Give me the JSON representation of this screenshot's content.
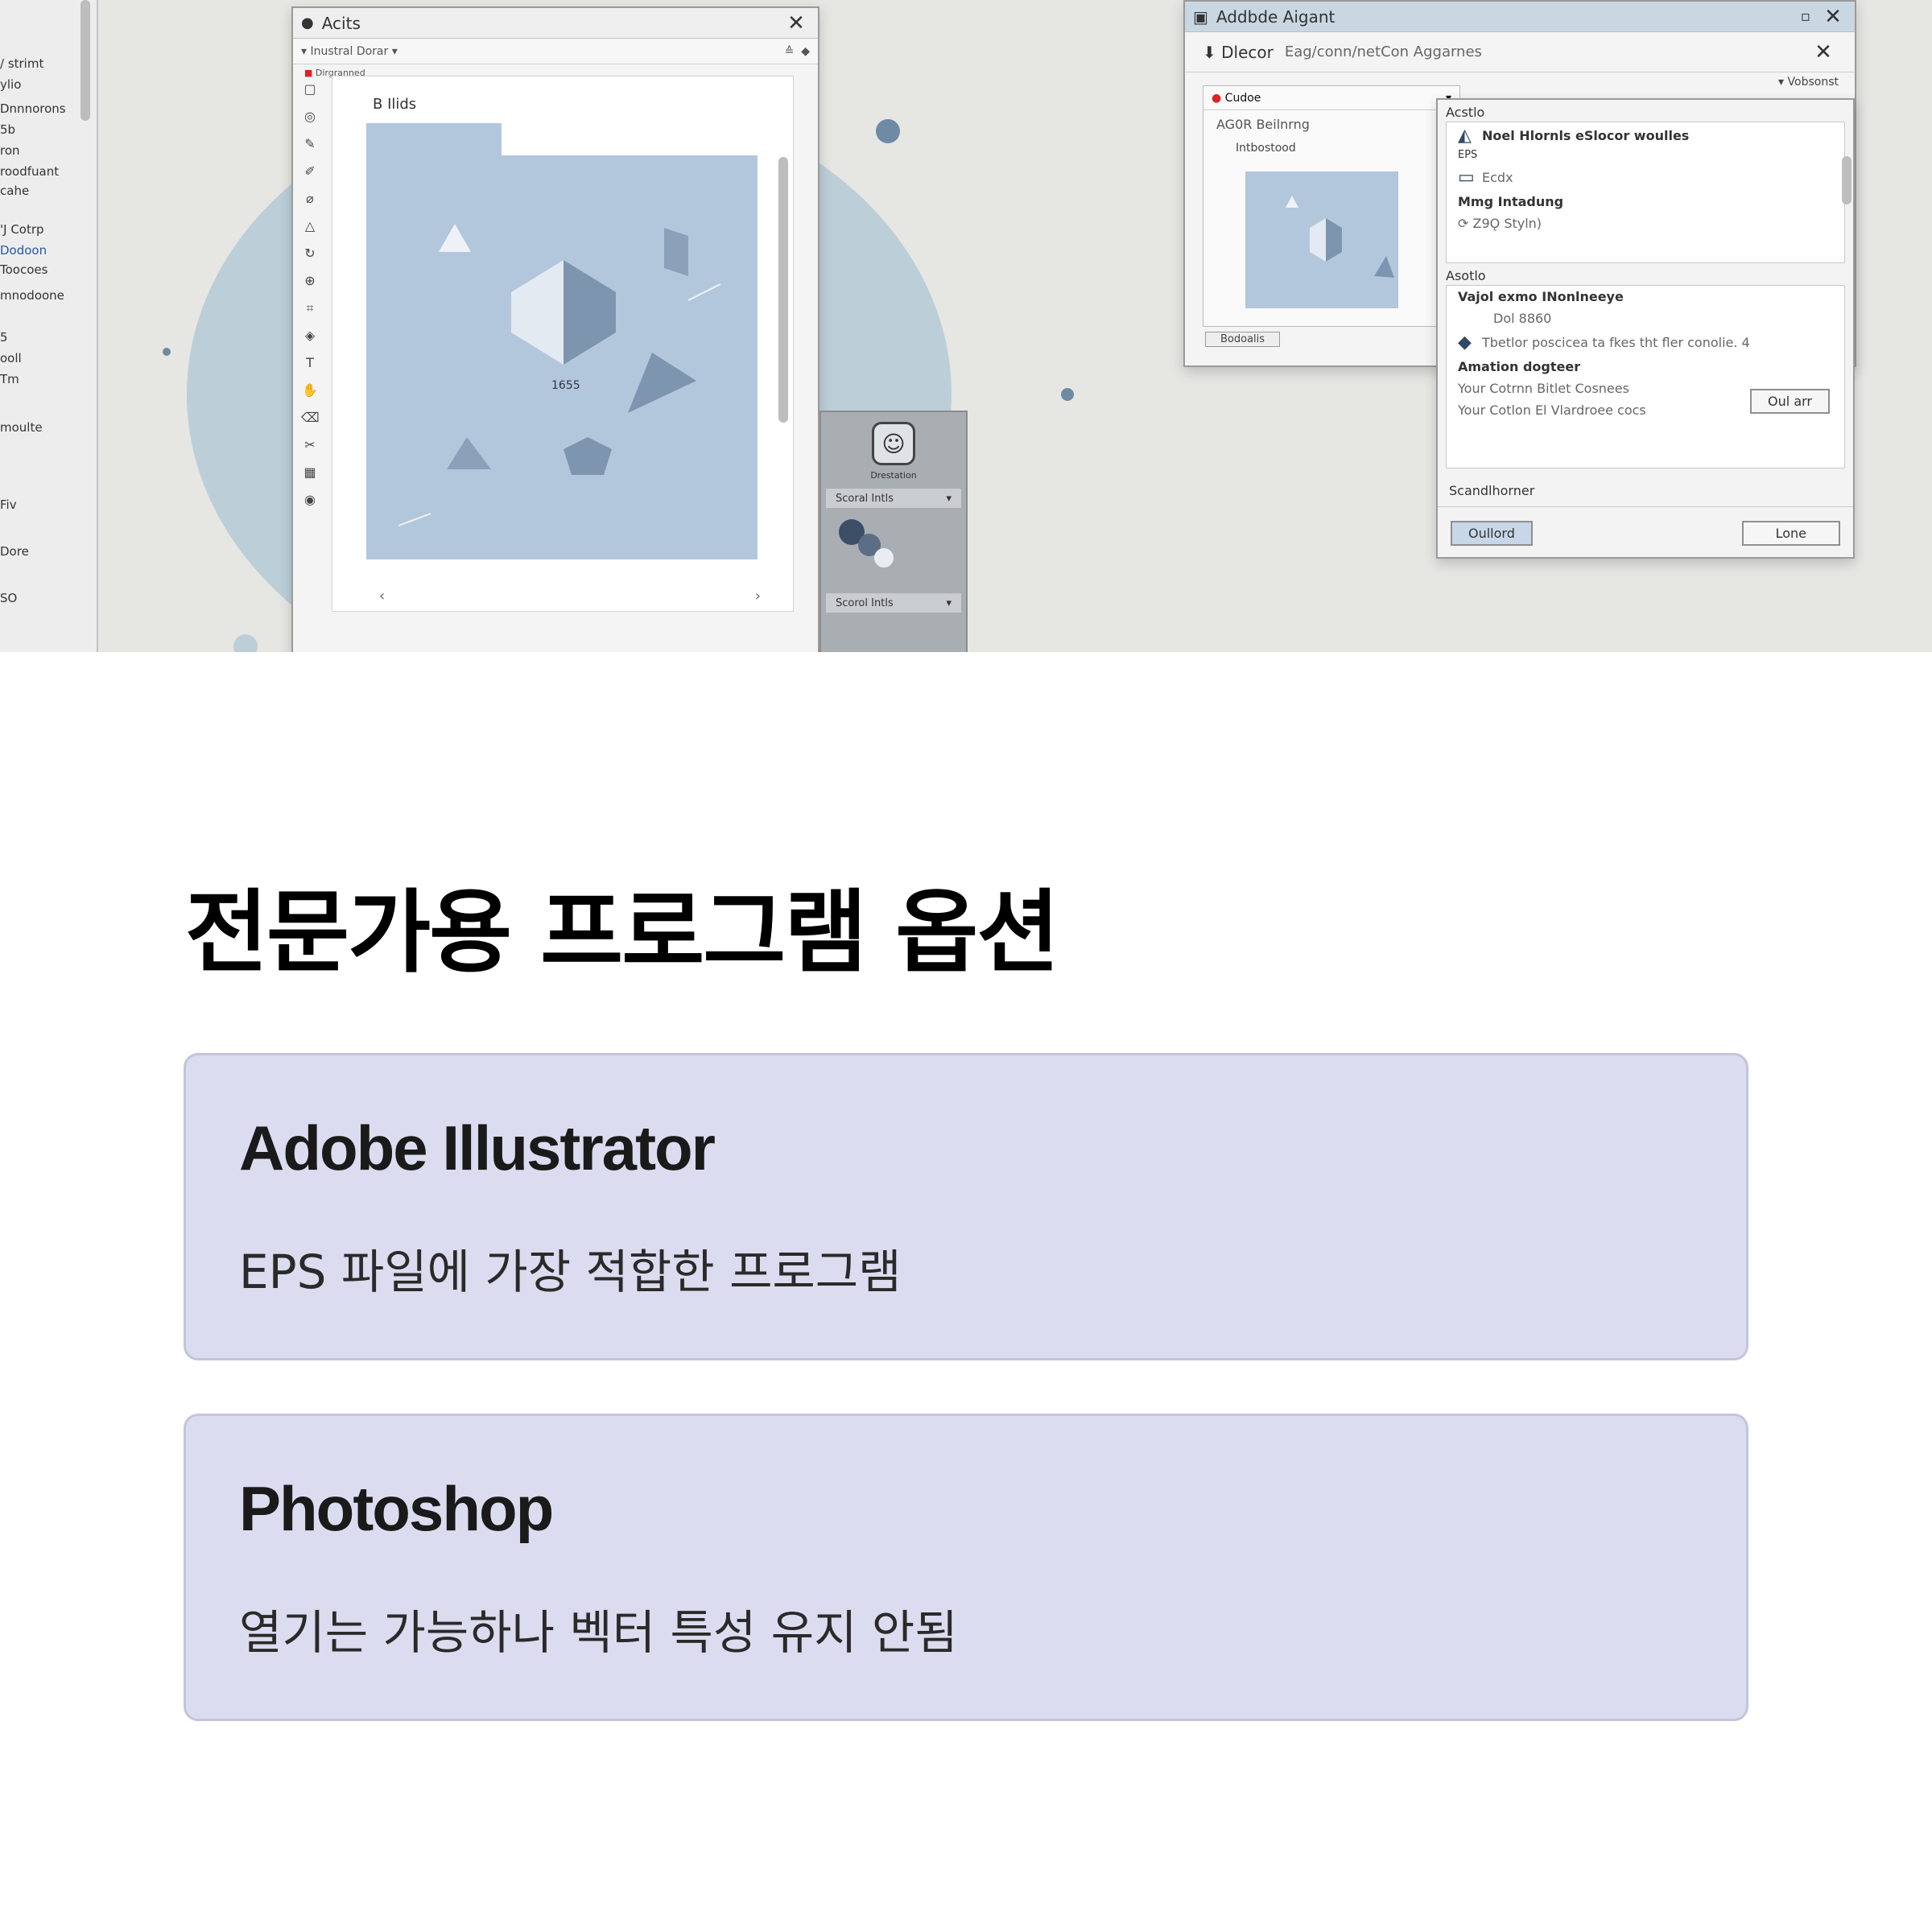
{
  "screenshot": {
    "left_strip": {
      "items": [
        "/ strimt",
        "ylio",
        "Dnnnorons",
        "5b",
        "ron",
        "roodfuant",
        "cahe",
        "'J Cotrp",
        "Dodoon",
        "Toocoes",
        "mnodoone",
        "5",
        "ooll",
        "Tm",
        "moulte",
        "Fiv",
        "Dore",
        "SO"
      ]
    },
    "doc_window": {
      "title": "Acits",
      "toolbar_label": "Inustral Dorar",
      "sublabel": "Dirgranned",
      "canvas_label": "B Ilids",
      "art_label": "1655"
    },
    "side_panel": {
      "icon_caption": "Drestation",
      "dropdown_1": "Scoral Intls",
      "dropdown_2": "Scorol Intls"
    },
    "dialog": {
      "title": "Addbde Aigant",
      "row_label": "Dlecor",
      "row_path": "Eag/conn/netCon Aggarnes",
      "options_drop": "Vobsonst",
      "left_header": "Cudoe",
      "left_sub": "AG0R Beilnrng",
      "left_sub2": "Intbostood",
      "left_button": "Bodoalis"
    },
    "sub_dialog": {
      "sec1_head": "Acstlo",
      "line_1": "Noel Hlornls  eSlocor woulles",
      "line_1b": "EPS",
      "line_2": "Ecdx",
      "line_3": "Mmg Intadung",
      "line_4": "Z9Ǫ Styln)",
      "sec2_head": "Asotlo",
      "line_5": "Vajol exmo INonlneeye",
      "line_6": "Dol 8860",
      "line_7": "Tbetlor poscicea ta fkes tht fler conolie.  4",
      "line_8": "Amation dogteer",
      "line_9": "Your Cotrnn Bitlet Cosnees",
      "line_10": "Your Cotlon El Vlardroee cocs",
      "btn_inner": "Oul arr",
      "footer_label": "Scandlhorner",
      "btn_left": "Oullord",
      "btn_right": "Lone"
    }
  },
  "content": {
    "heading": "전문가용 프로그램 옵션",
    "cards": [
      {
        "title": "Adobe Illustrator",
        "description": "EPS 파일에 가장 적합한 프로그램"
      },
      {
        "title": "Photoshop",
        "description": "열기는 가능하나 벡터 특성 유지 안됨"
      }
    ]
  },
  "colors": {
    "card_bg": "#dcdcf0",
    "card_border": "#c4c4dc",
    "art_bg": "#b3c7dc",
    "art_shape": "#7e95b0"
  }
}
